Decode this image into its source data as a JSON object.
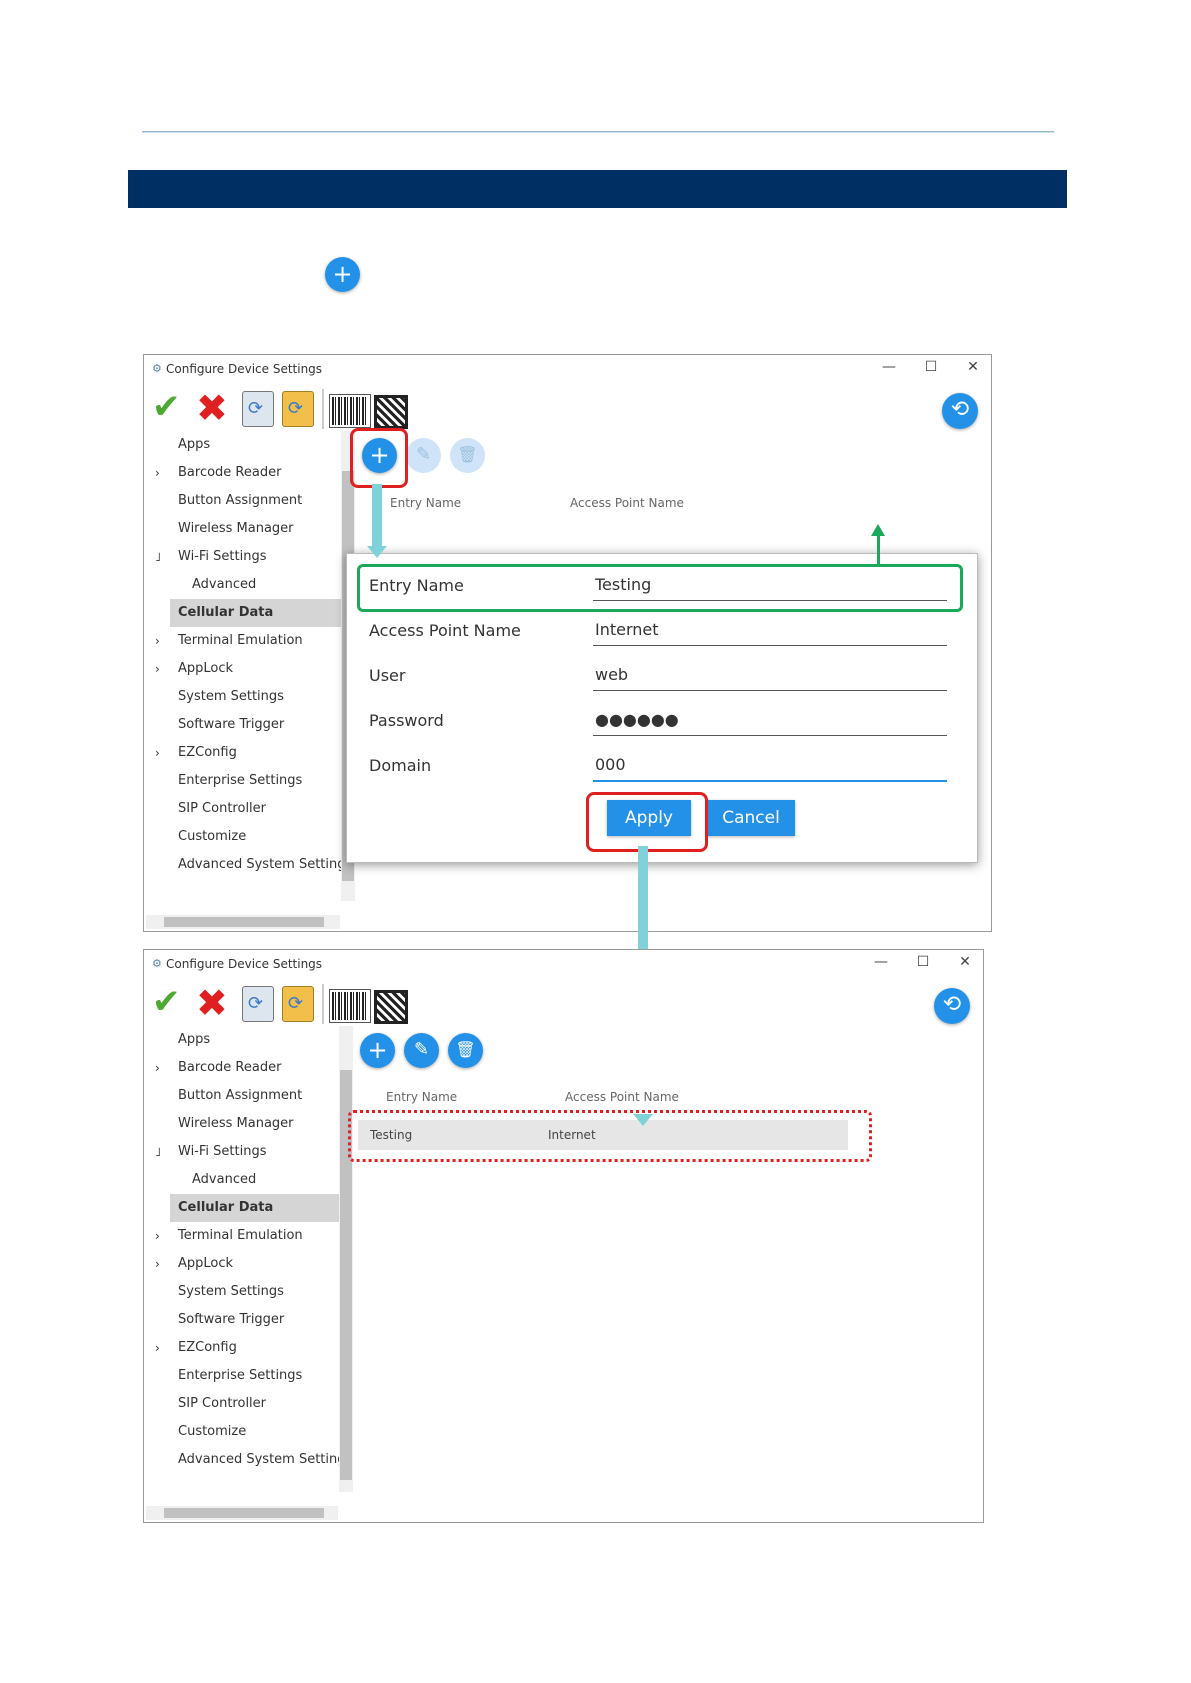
{
  "window_title": "Configure Device Settings",
  "window_controls": {
    "minimize": "—",
    "maximize": "☐",
    "close": "✕"
  },
  "sidebar": {
    "items": [
      {
        "label": "Apps",
        "arrow": ""
      },
      {
        "label": "Barcode Reader",
        "arrow": "›"
      },
      {
        "label": "Button Assignment",
        "arrow": ""
      },
      {
        "label": "Wireless Manager",
        "arrow": ""
      },
      {
        "label": "Wi-Fi Settings",
        "arrow": "˩"
      },
      {
        "label": "Advanced",
        "arrow": ""
      },
      {
        "label": "Cellular Data",
        "arrow": ""
      },
      {
        "label": "Terminal Emulation",
        "arrow": "›"
      },
      {
        "label": "AppLock",
        "arrow": "›"
      },
      {
        "label": "System Settings",
        "arrow": ""
      },
      {
        "label": "Software Trigger",
        "arrow": ""
      },
      {
        "label": "EZConfig",
        "arrow": "›"
      },
      {
        "label": "Enterprise Settings",
        "arrow": ""
      },
      {
        "label": "SIP Controller",
        "arrow": ""
      },
      {
        "label": "Customize",
        "arrow": ""
      },
      {
        "label": "Advanced System Settings",
        "arrow": ""
      }
    ],
    "selected": "Cellular Data"
  },
  "list_headers": {
    "entry_name": "Entry Name",
    "access_point_name": "Access Point Name"
  },
  "dialog": {
    "fields": [
      {
        "label": "Entry Name",
        "value": "Testing"
      },
      {
        "label": "Access Point Name",
        "value": "Internet"
      },
      {
        "label": "User",
        "value": "web"
      },
      {
        "label": "Password",
        "value": "●●●●●●"
      },
      {
        "label": "Domain",
        "value": "000"
      }
    ],
    "apply_label": "Apply",
    "cancel_label": "Cancel"
  },
  "result_row": {
    "entry_name": "Testing",
    "access_point_name": "Internet"
  },
  "icons": {
    "add": "+",
    "edit": "✎",
    "delete": "🗑",
    "restore": "⟲",
    "save": "✔",
    "discard": "✖"
  },
  "colors": {
    "banner": "#003063",
    "accent": "#2491e8",
    "highlight_red": "#e02020",
    "highlight_green": "#1aa85a",
    "connector": "#7fd3d8"
  }
}
